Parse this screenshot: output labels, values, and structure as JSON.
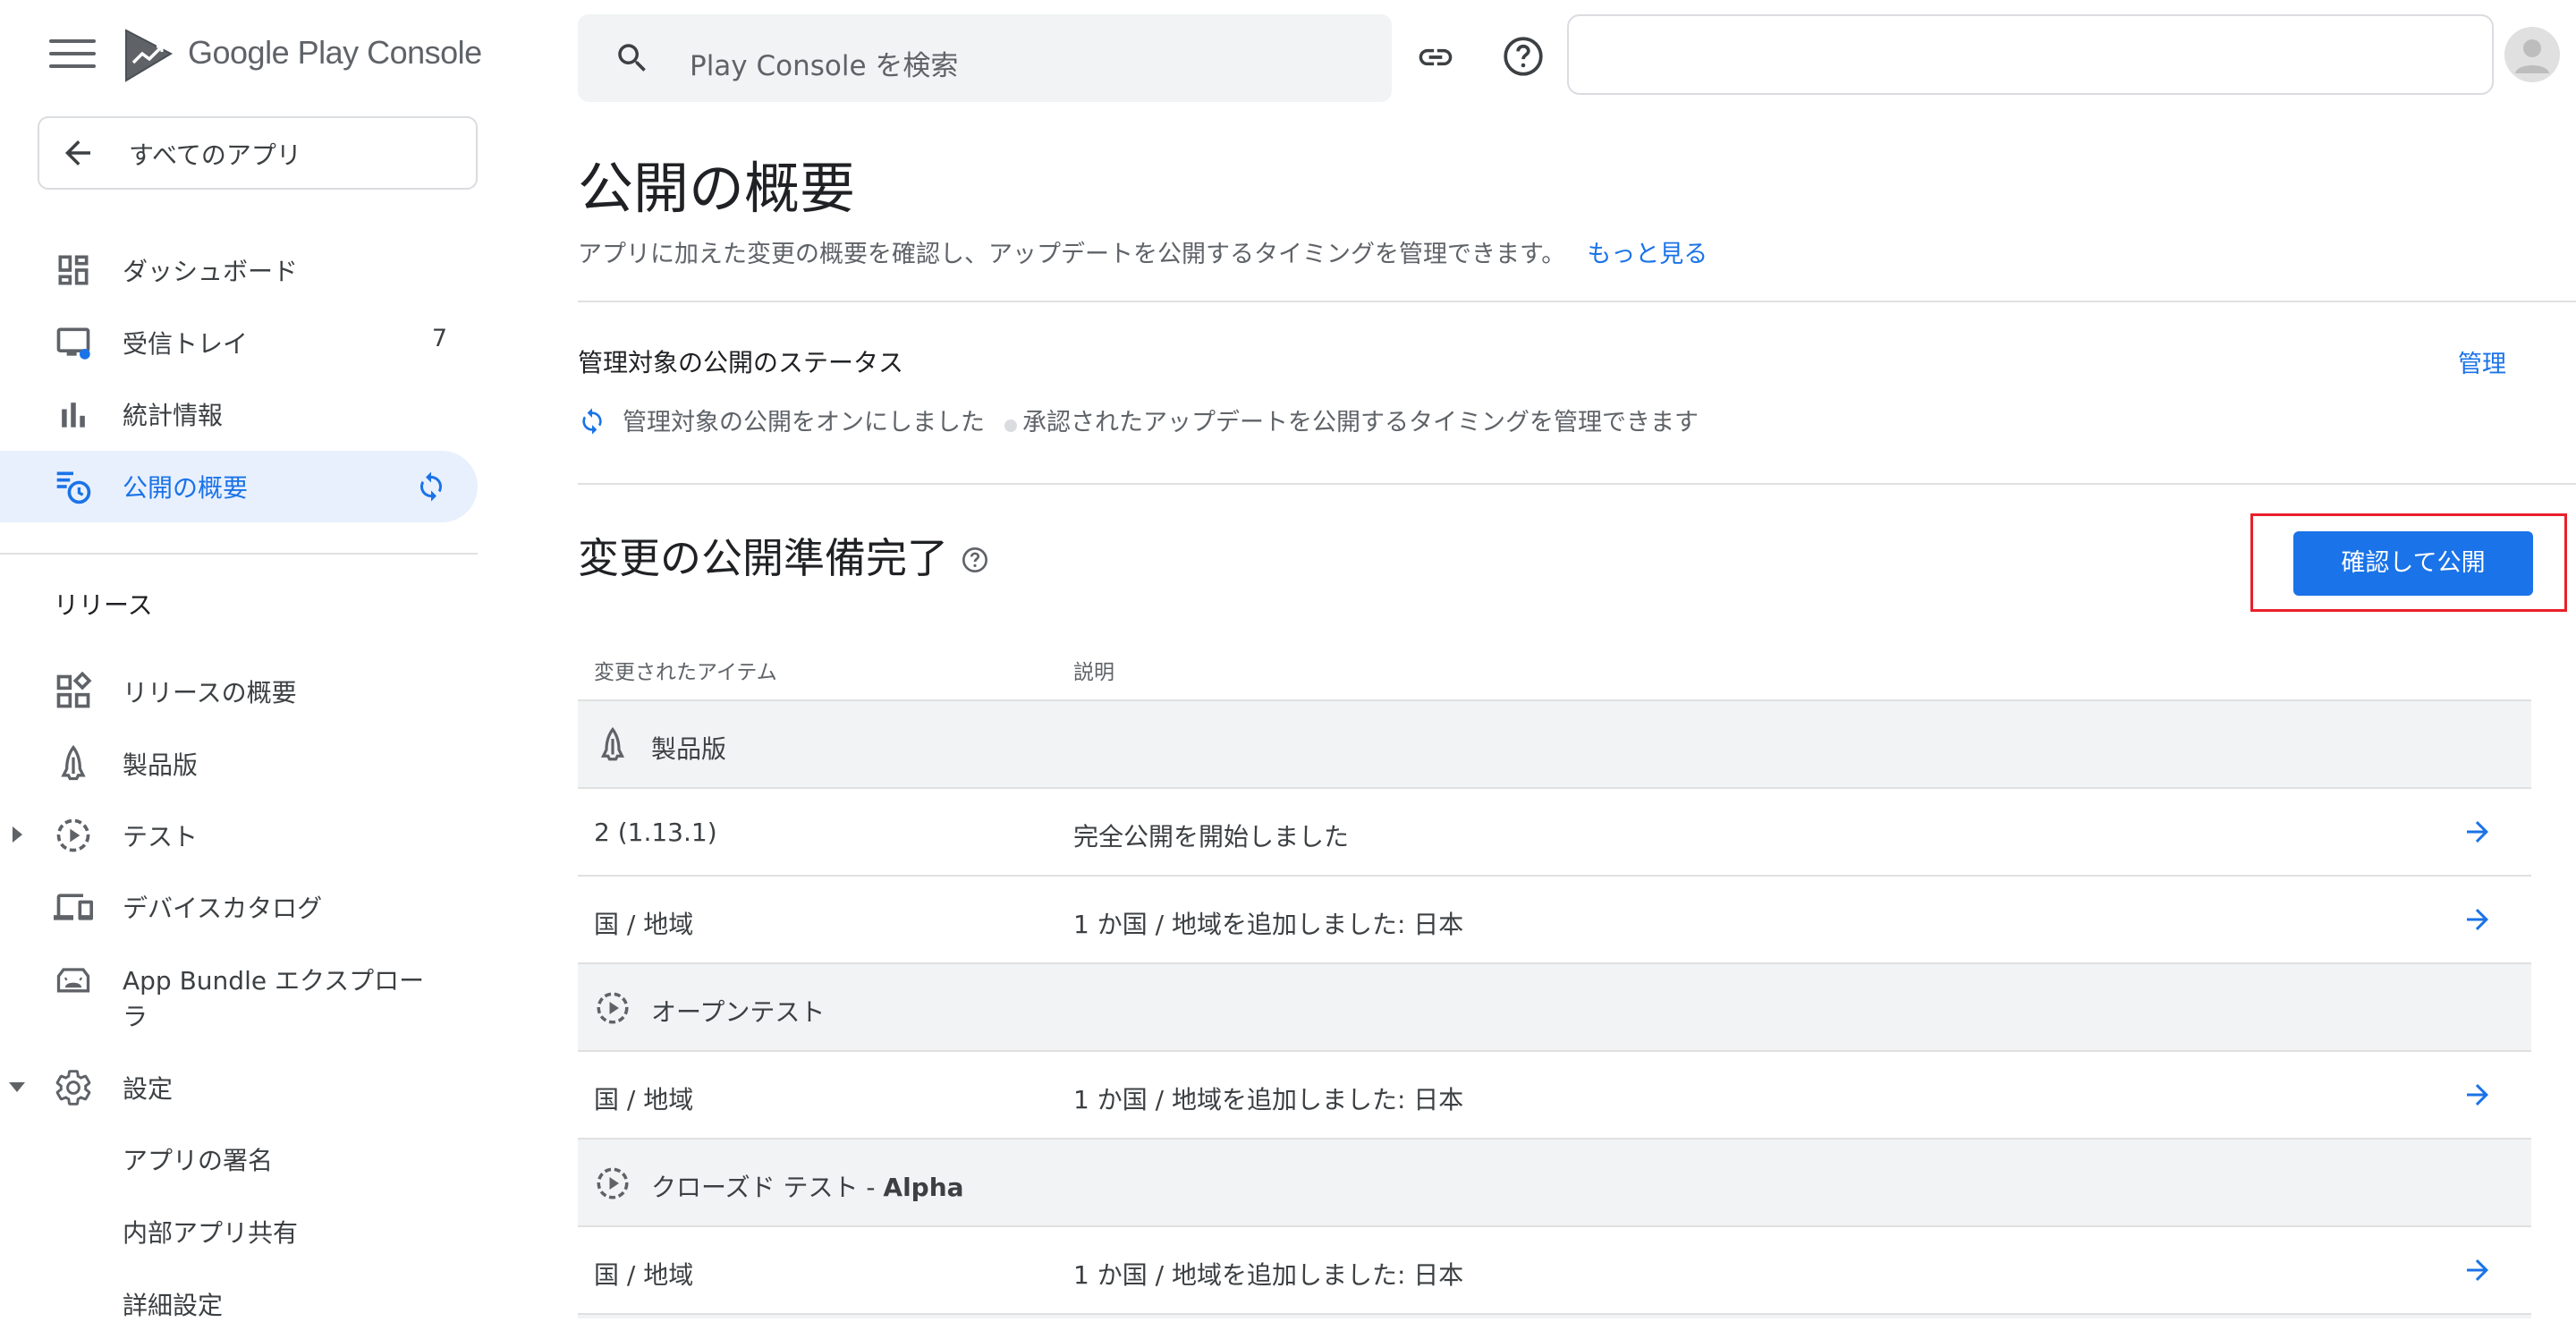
{
  "brand": {
    "name": "Google Play Console"
  },
  "colors": {
    "accent": "#1a73e8",
    "active_bg": "#e8f0fe",
    "highlight": "#e8202a"
  },
  "back": {
    "label": "すべてのアプリ"
  },
  "nav": {
    "dashboard": "ダッシュボード",
    "inbox": "受信トレイ",
    "inbox_count": "7",
    "stats": "統計情報",
    "publishing": "公開の概要"
  },
  "release_section": {
    "header": "リリース",
    "overview": "リリースの概要",
    "production": "製品版",
    "testing": "テスト",
    "device_catalog": "デバイスカタログ",
    "bundle_explorer_line1": "App Bundle エクスプロー",
    "bundle_explorer_line2": "ラ",
    "settings": "設定",
    "app_signing": "アプリの署名",
    "internal_sharing": "内部アプリ共有",
    "advanced": "詳細設定"
  },
  "search": {
    "placeholder": "Play Console を検索"
  },
  "main": {
    "title": "公開の概要",
    "description": "アプリに加えた変更の概要を確認し、アップデートを公開するタイミングを管理できます。",
    "learn_more": "もっと見る",
    "managed_title": "管理対象の公開のステータス",
    "managed_link": "管理",
    "managed_status": "管理対象の公開をオンにしました",
    "managed_hint": "承認されたアップデートを公開するタイミングを管理できます",
    "ready_title": "変更の公開準備完了",
    "publish_button": "確認して公開"
  },
  "table": {
    "col_item": "変更されたアイテム",
    "col_desc": "説明",
    "rows": [
      {
        "type": "group",
        "icon": "production-icon",
        "label": "製品版"
      },
      {
        "type": "change",
        "item": "2 (1.13.1)",
        "desc": "完全公開を開始しました"
      },
      {
        "type": "change",
        "item": "国 / 地域",
        "desc": "1 か国 / 地域を追加しました: 日本"
      },
      {
        "type": "group",
        "icon": "testing-icon",
        "label": "オープンテスト"
      },
      {
        "type": "change",
        "item": "国 / 地域",
        "desc": "1 か国 / 地域を追加しました: 日本"
      },
      {
        "type": "group",
        "icon": "testing-icon",
        "label": "クローズド テスト - ",
        "label_bold": "Alpha"
      },
      {
        "type": "change",
        "item": "国 / 地域",
        "desc": "1 か国 / 地域を追加しました: 日本"
      }
    ]
  }
}
